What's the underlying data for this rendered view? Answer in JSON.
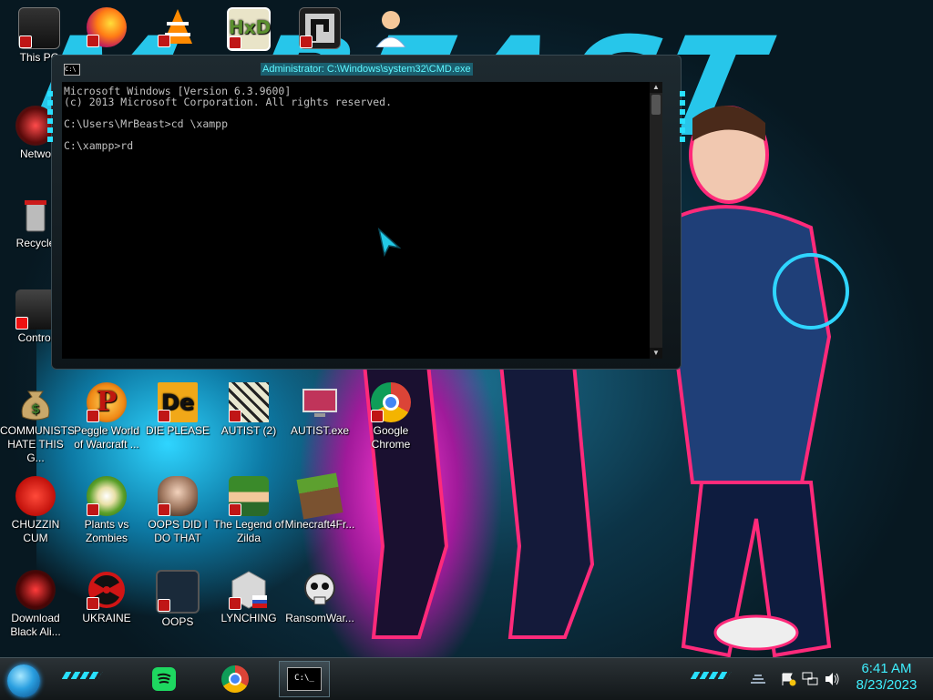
{
  "desktop": {
    "icons": [
      {
        "label": "This PC",
        "icon": "this-pc-icon"
      },
      {
        "label": "",
        "icon": "firefox-icon"
      },
      {
        "label": "",
        "icon": "vlc-icon"
      },
      {
        "label": "",
        "icon": "hxd-icon"
      },
      {
        "label": "",
        "icon": "app-icon"
      },
      {
        "label": "",
        "icon": "doctor-icon"
      },
      {
        "label": "Netwo",
        "icon": "network-icon"
      },
      {
        "label": "Recycle",
        "icon": "recycle-bin-icon"
      },
      {
        "label": "Control",
        "icon": "control-panel-icon"
      },
      {
        "label": "COMMUNISTS HATE THIS G...",
        "icon": "money-bag-icon"
      },
      {
        "label": "Peggle World of Warcraft ...",
        "icon": "peggle-icon"
      },
      {
        "label": "DIE PLEASE",
        "icon": "die-please-icon"
      },
      {
        "label": "AUTIST (2)",
        "icon": "autist-2-icon"
      },
      {
        "label": "AUTIST.exe",
        "icon": "autist-exe-icon"
      },
      {
        "label": "Google Chrome",
        "icon": "chrome-icon"
      },
      {
        "label": "CHUZZIN CUM",
        "icon": "chuzzle-icon"
      },
      {
        "label": "Plants vs Zombies",
        "icon": "plants-vs-zombies-icon"
      },
      {
        "label": "OOPS DID I DO THAT",
        "icon": "portrait-icon"
      },
      {
        "label": "The Legend of Zilda",
        "icon": "zelda-icon"
      },
      {
        "label": "Minecraft4Fr...",
        "icon": "minecraft-icon"
      },
      {
        "label": "Download Black Ali...",
        "icon": "black-alien-icon"
      },
      {
        "label": "UKRAINE",
        "icon": "radiation-icon"
      },
      {
        "label": "OOPS",
        "icon": "oops-icon"
      },
      {
        "label": "LYNCHING",
        "icon": "lynching-icon"
      },
      {
        "label": "RansomWar...",
        "icon": "ransomware-skull-icon"
      }
    ]
  },
  "cmd_window": {
    "title": "Administrator: C:\\Windows\\system32\\CMD.exe",
    "icon_text": "C:\\",
    "lines": [
      "Microsoft Windows [Version 6.3.9600]",
      "(c) 2013 Microsoft Corporation. All rights reserved.",
      "",
      "C:\\Users\\MrBeast>cd \\xampp",
      "",
      "C:\\xampp>rd"
    ],
    "scroll_up": "▲",
    "scroll_down": "▼"
  },
  "taskbar": {
    "pinned": [
      {
        "name": "spotify-button",
        "icon": "spotify-icon"
      },
      {
        "name": "chrome-button",
        "icon": "chrome-icon"
      },
      {
        "name": "cmd-button",
        "icon": "cmd-icon",
        "active": true,
        "text": "C:\\_"
      }
    ],
    "tray_icons": [
      "show-hidden-icon",
      "flag-warning-icon",
      "network-icon",
      "volume-icon"
    ],
    "clock": {
      "time": "6:41 AM",
      "date": "8/23/2023"
    }
  },
  "colors": {
    "accent": "#29e0ff",
    "clock": "#3ff0ff",
    "titlebar_text": "#5ff7ff"
  }
}
